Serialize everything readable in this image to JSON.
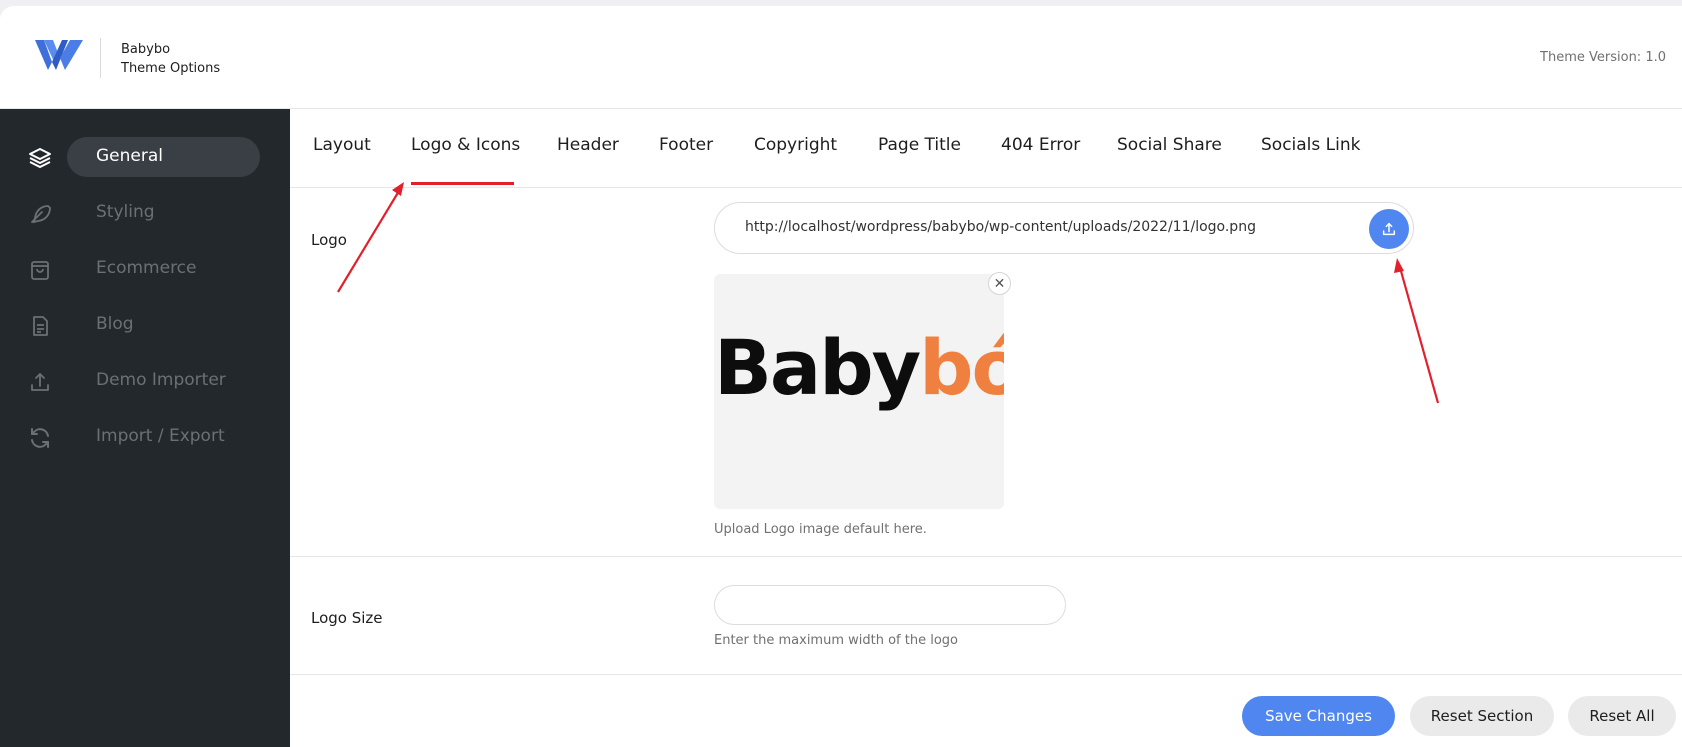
{
  "header": {
    "brand_name": "Babybo",
    "brand_subtitle": "Theme Options",
    "version": "Theme Version: 1.0"
  },
  "sidebar": {
    "items": [
      {
        "label": "General",
        "icon": "layers-icon",
        "active": true
      },
      {
        "label": "Styling",
        "icon": "feather-icon",
        "active": false
      },
      {
        "label": "Ecommerce",
        "icon": "shopping-bag-icon",
        "active": false
      },
      {
        "label": "Blog",
        "icon": "document-icon",
        "active": false
      },
      {
        "label": "Demo Importer",
        "icon": "upload-icon",
        "active": false
      },
      {
        "label": "Import / Export",
        "icon": "refresh-icon",
        "active": false
      }
    ]
  },
  "tabs": [
    {
      "label": "Layout"
    },
    {
      "label": "Logo & Icons",
      "active": true
    },
    {
      "label": "Header"
    },
    {
      "label": "Footer"
    },
    {
      "label": "Copyright"
    },
    {
      "label": "Page Title"
    },
    {
      "label": "404 Error"
    },
    {
      "label": "Social Share"
    },
    {
      "label": "Socials Link"
    }
  ],
  "fields": {
    "logo": {
      "label": "Logo",
      "value": "http://localhost/wordpress/babybo/wp-content/uploads/2022/11/logo.png",
      "preview_dark": "Baby",
      "preview_orange": "bó",
      "help": "Upload Logo image default here."
    },
    "logo_size": {
      "label": "Logo Size",
      "value": "",
      "help": "Enter the maximum width of the logo"
    }
  },
  "actions": {
    "save": "Save Changes",
    "reset_section": "Reset Section",
    "reset_all": "Reset All"
  },
  "colors": {
    "sidebar_bg": "#23282d",
    "accent_blue": "#4f86f0",
    "tab_underline": "#e2202c",
    "logo_orange": "#f08040",
    "annotation_red": "#e2202c"
  }
}
